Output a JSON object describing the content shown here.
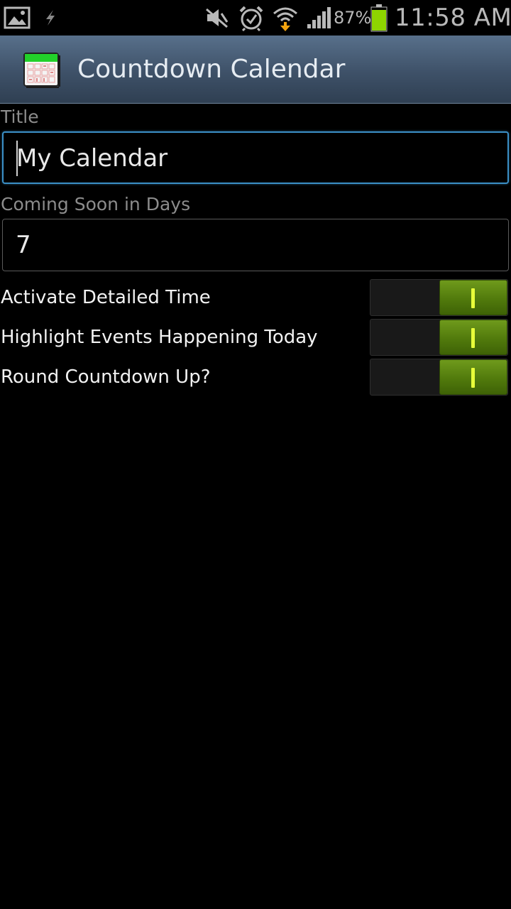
{
  "status_bar": {
    "icons": [
      "gallery-icon",
      "usb-icon",
      "mute-icon",
      "alarm-icon",
      "wifi-icon",
      "signal-icon",
      "battery-icon"
    ],
    "battery_percent": "87%",
    "time": "11:58 AM",
    "colors": {
      "icon": "#b9b9b9",
      "battery_fill": "#8ed400",
      "download_arrow": "#f2a30f"
    }
  },
  "action_bar": {
    "title": "Countdown Calendar",
    "icon": "calendar-icon"
  },
  "form": {
    "title_label": "Title",
    "title_value": "My Calendar",
    "coming_soon_label": "Coming Soon in Days",
    "coming_soon_value": "7",
    "toggles": [
      {
        "label": "Activate Detailed Time",
        "checked": true
      },
      {
        "label": "Highlight Events Happening Today",
        "checked": true
      },
      {
        "label": "Round Countdown Up?",
        "checked": true
      }
    ]
  },
  "colors": {
    "focus_border": "#3b8fc6",
    "switch_on": "#5a8412",
    "switch_grip": "#e8ff3a",
    "label_gray": "#8c8c8c"
  }
}
